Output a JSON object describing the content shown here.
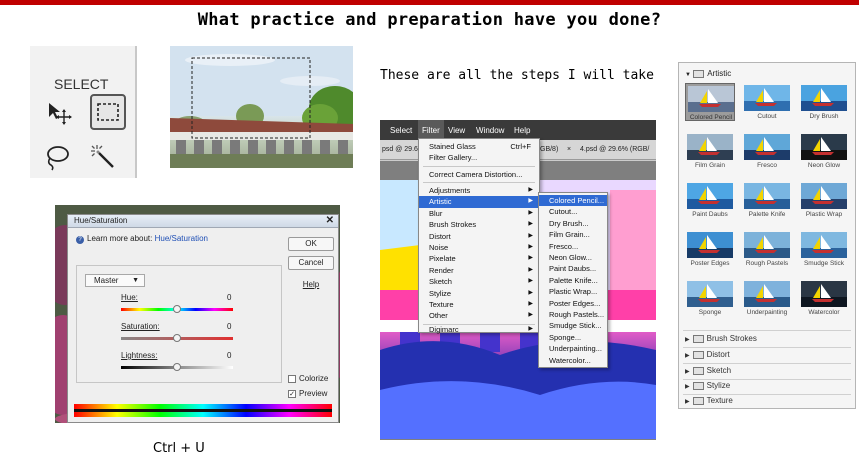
{
  "colors": {
    "accent_bar": "#c00000",
    "menu_highlight": "#2f6ad3",
    "link": "#1f4fb5"
  },
  "slide": {
    "title": "What practice and preparation have you done?",
    "steps_caption": "These are all the steps I will take",
    "shortcut_caption": "Ctrl + U"
  },
  "toolbox": {
    "select_label": "SELECT",
    "tools": [
      "move-tool-icon",
      "rectangular-marquee-icon",
      "lasso-icon",
      "magic-wand-icon"
    ]
  },
  "hue_saturation": {
    "title": "Hue/Saturation",
    "learn_text": "Learn more about:",
    "learn_link": "Hue/Saturation",
    "buttons": {
      "ok": "OK",
      "cancel": "Cancel",
      "help": "Help"
    },
    "channel": "Master",
    "hue": {
      "label": "Hue:",
      "value": "0"
    },
    "saturation": {
      "label": "Saturation:",
      "value": "0"
    },
    "lightness": {
      "label": "Lightness:",
      "value": "0"
    },
    "colorize": {
      "label": "Colorize",
      "checked": false
    },
    "preview": {
      "label": "Preview",
      "checked": true
    }
  },
  "filter_menu": {
    "menubar": [
      "Select",
      "Filter",
      "View",
      "Window",
      "Help"
    ],
    "tabs": [
      "psd @ 29.6%",
      "GB/8)",
      "4.psd @ 29.6% (RGB/"
    ],
    "items": [
      {
        "label": "Stained Glass",
        "shortcut": "Ctrl+F"
      },
      {
        "label": "Filter Gallery..."
      },
      {
        "label": "Correct Camera Distortion..."
      },
      {
        "label": "Adjustments"
      },
      {
        "label": "Artistic"
      },
      {
        "label": "Blur"
      },
      {
        "label": "Brush Strokes"
      },
      {
        "label": "Distort"
      },
      {
        "label": "Noise"
      },
      {
        "label": "Pixelate"
      },
      {
        "label": "Render"
      },
      {
        "label": "Sketch"
      },
      {
        "label": "Stylize"
      },
      {
        "label": "Texture"
      },
      {
        "label": "Other"
      },
      {
        "label": "Digimarc"
      }
    ],
    "artistic_submenu": [
      "Colored Pencil...",
      "Cutout...",
      "Dry Brush...",
      "Film Grain...",
      "Fresco...",
      "Neon Glow...",
      "Paint Daubs...",
      "Palette Knife...",
      "Plastic Wrap...",
      "Poster Edges...",
      "Rough Pastels...",
      "Smudge Stick...",
      "Sponge...",
      "Underpainting...",
      "Watercolor..."
    ]
  },
  "filter_gallery": {
    "category": "Artistic",
    "thumbnails": [
      "Colored Pencil",
      "Cutout",
      "Dry Brush",
      "Film Grain",
      "Fresco",
      "Neon Glow",
      "Paint Daubs",
      "Palette Knife",
      "Plastic Wrap",
      "Poster Edges",
      "Rough Pastels",
      "Smudge Stick",
      "Sponge",
      "Underpainting",
      "Watercolor"
    ],
    "other_categories": [
      "Brush Strokes",
      "Distort",
      "Sketch",
      "Stylize",
      "Texture"
    ]
  }
}
